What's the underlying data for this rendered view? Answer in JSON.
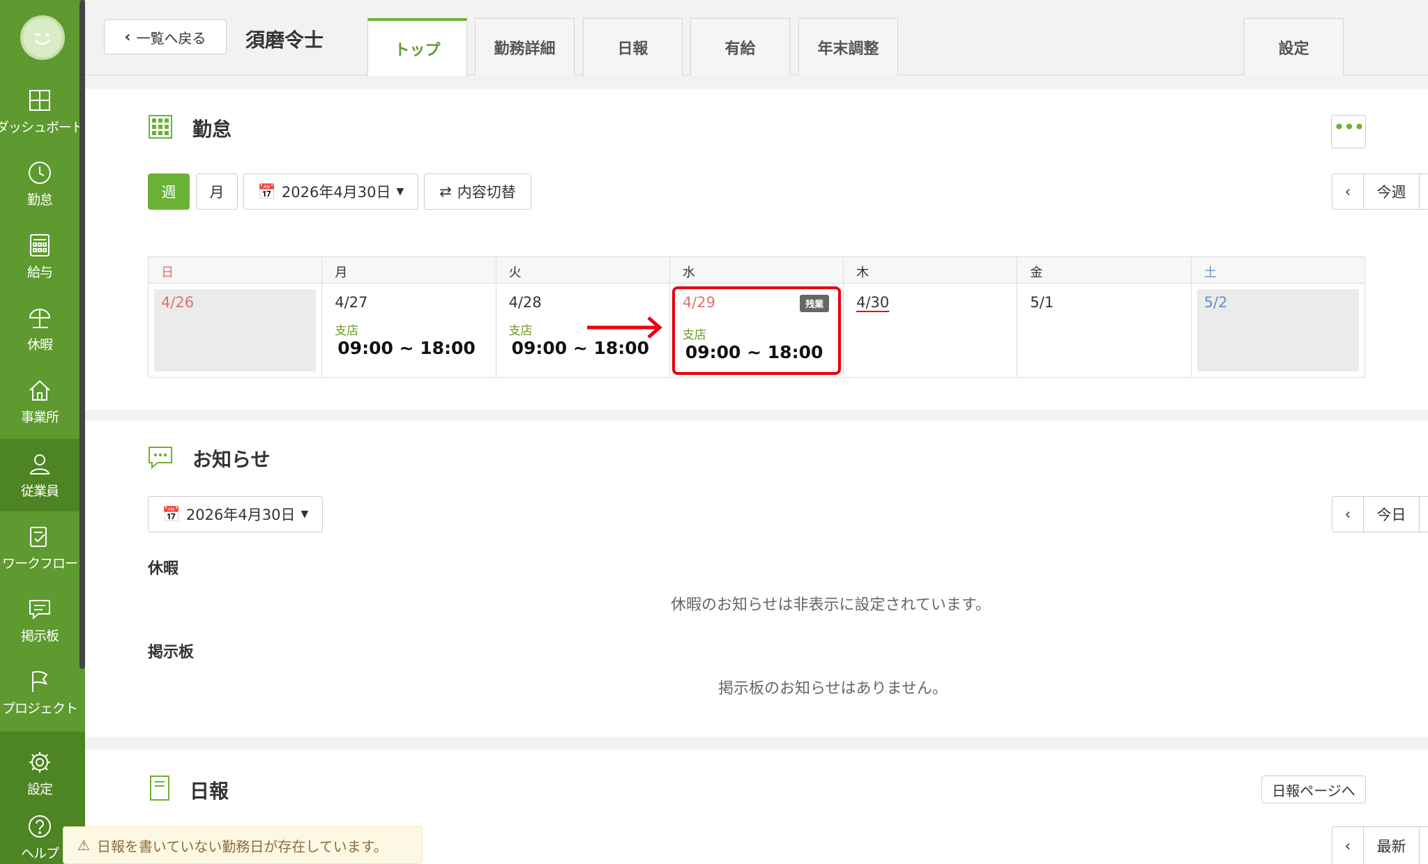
{
  "sidebar": {
    "items": [
      {
        "label": "ダッシュボード",
        "icon": "dashboard-icon"
      },
      {
        "label": "勤怠",
        "icon": "clock-icon"
      },
      {
        "label": "給与",
        "icon": "calculator-icon"
      },
      {
        "label": "休暇",
        "icon": "umbrella-icon"
      },
      {
        "label": "事業所",
        "icon": "home-icon"
      },
      {
        "label": "従業員",
        "icon": "user-icon"
      },
      {
        "label": "ワークフロー",
        "icon": "checklist-icon"
      },
      {
        "label": "掲示板",
        "icon": "message-icon"
      },
      {
        "label": "プロジェクト",
        "icon": "flag-icon"
      },
      {
        "label": "設定",
        "icon": "gear-icon"
      },
      {
        "label": "ヘルプ",
        "icon": "help-icon"
      }
    ]
  },
  "header": {
    "back_label": "一覧へ戻る",
    "employee_name": "須磨令士",
    "tabs": [
      "トップ",
      "勤務詳細",
      "日報",
      "有給",
      "年末調整"
    ],
    "settings_tab": "設定"
  },
  "attendance": {
    "title": "勤怠",
    "view_week": "週",
    "view_month": "月",
    "date_picker": "2026年4月30日",
    "switch_label": "内容切替",
    "nav_current": "今週",
    "weekdays": [
      "日",
      "月",
      "火",
      "水",
      "木",
      "金",
      "土"
    ],
    "days": [
      {
        "date": "4/26"
      },
      {
        "date": "4/27",
        "location": "支店",
        "time": "09:00 ~ 18:00"
      },
      {
        "date": "4/28",
        "location": "支店",
        "time": "09:00 ~ 18:00"
      },
      {
        "date": "4/29",
        "location": "支店",
        "time": "09:00 ~ 18:00",
        "badge": "残業"
      },
      {
        "date": "4/30"
      },
      {
        "date": "5/1"
      },
      {
        "date": "5/2"
      }
    ]
  },
  "notices": {
    "title": "お知らせ",
    "date_picker": "2026年4月30日",
    "nav_current": "今日",
    "leave_heading": "休暇",
    "leave_message": "休暇のお知らせは非表示に設定されています。",
    "board_heading": "掲示板",
    "board_message": "掲示板のお知らせはありません。"
  },
  "daily_report": {
    "title": "日報",
    "page_link": "日報ページへ",
    "nav_current": "最新",
    "warning": "日報を書いていない勤務日が存在しています。"
  },
  "colors": {
    "sidebar_green": "#5e9a2f",
    "accent_green": "#6ab235",
    "sunday_red": "#e07070",
    "saturday_blue": "#6a8fd0",
    "highlight_red": "#e8000d"
  }
}
